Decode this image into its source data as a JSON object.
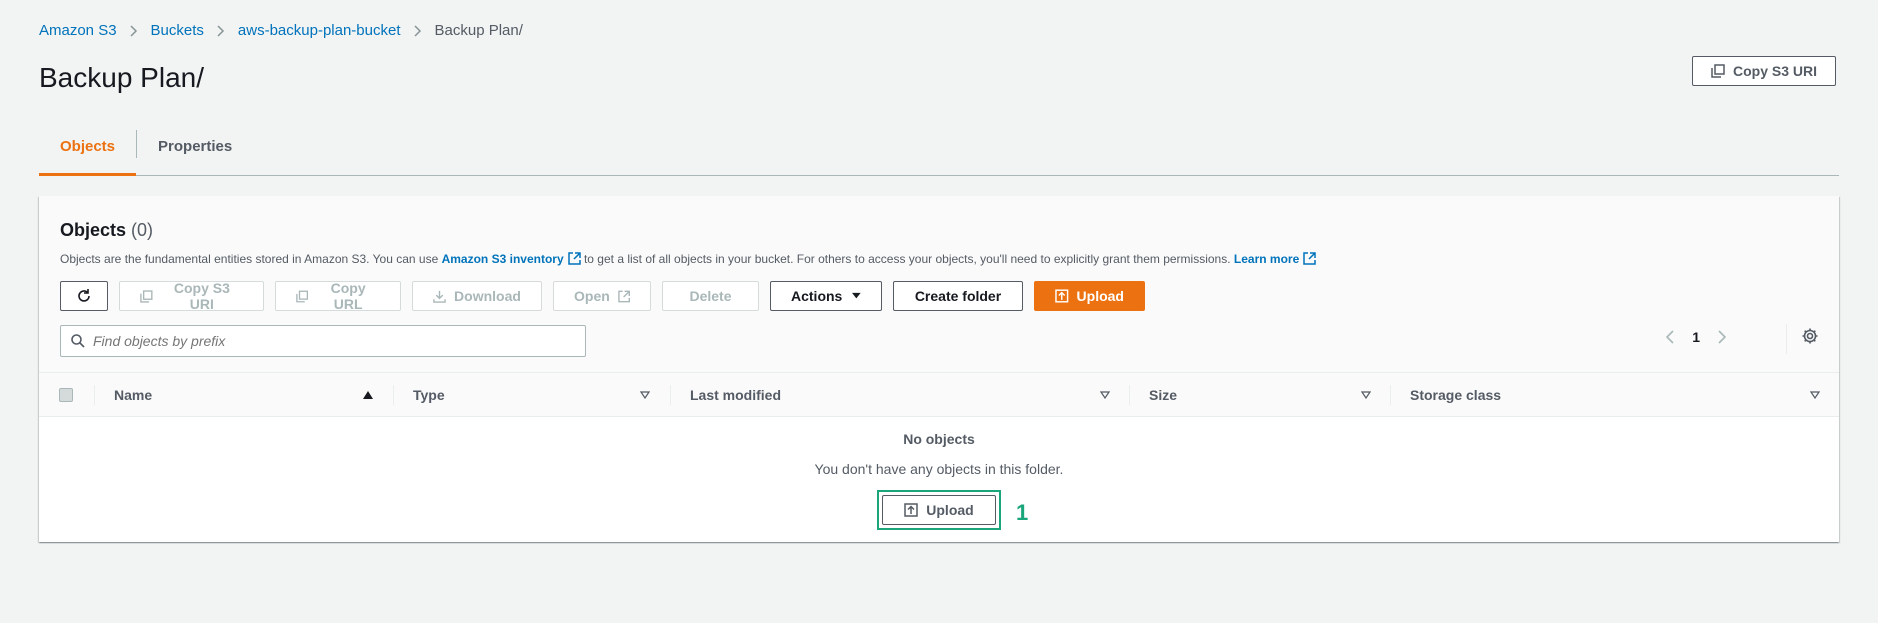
{
  "breadcrumb": {
    "items": [
      "Amazon S3",
      "Buckets",
      "aws-backup-plan-bucket"
    ],
    "current": "Backup Plan/"
  },
  "page": {
    "title": "Backup Plan/",
    "copy_uri_label": "Copy S3 URI"
  },
  "tabs": [
    {
      "label": "Objects",
      "active": true
    },
    {
      "label": "Properties",
      "active": false
    }
  ],
  "objects_panel": {
    "title": "Objects",
    "count": "(0)",
    "desc_part1": "Objects are the fundamental entities stored in Amazon S3. You can use",
    "inventory_link": "Amazon S3 inventory",
    "desc_part2": "to get a list of all objects in your bucket. For others to access your objects, you'll need to explicitly grant them permissions.",
    "learn_more": "Learn more",
    "toolbar": {
      "copy_s3_uri": "Copy S3 URI",
      "copy_url": "Copy URL",
      "download": "Download",
      "open": "Open",
      "delete": "Delete",
      "actions": "Actions",
      "create_folder": "Create folder",
      "upload": "Upload"
    },
    "search_placeholder": "Find objects by prefix",
    "page_number": "1",
    "columns": [
      "Name",
      "Type",
      "Last modified",
      "Size",
      "Storage class"
    ],
    "empty_title": "No objects",
    "empty_desc": "You don't have any objects in this folder.",
    "empty_upload": "Upload",
    "annotation": "1"
  },
  "colors": {
    "accent": "#ec7211",
    "link": "#0073bb",
    "annotation": "#1aa57b"
  }
}
